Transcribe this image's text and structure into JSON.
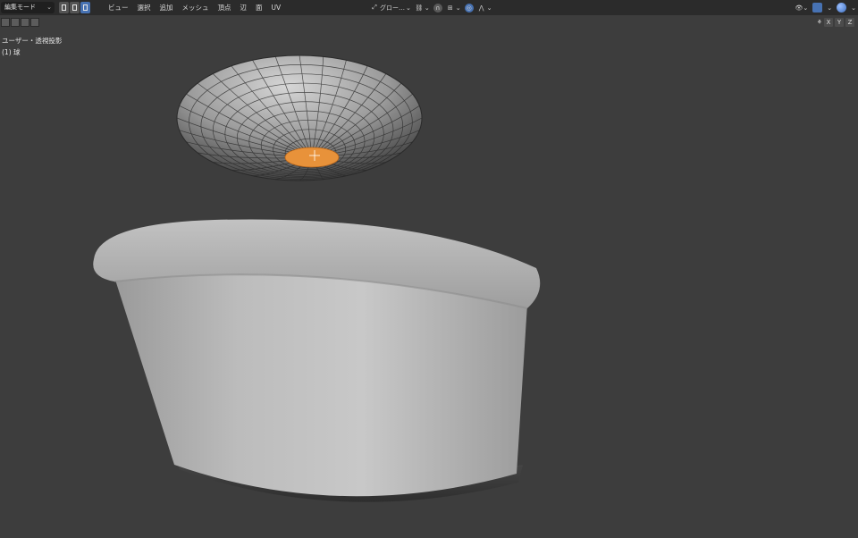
{
  "header": {
    "mode_label": "編集モード",
    "menu": [
      "ビュー",
      "選択",
      "追加",
      "メッシュ",
      "頂点",
      "辺",
      "面",
      "UV"
    ],
    "transform_orientation": "グロー…"
  },
  "viewport": {
    "view_name": "ユーザー・透視投影",
    "object_name": "(1) 球"
  },
  "axes": [
    "X",
    "Y",
    "Z"
  ],
  "colors": {
    "accent": "#4772b3",
    "selection": "#e8923a",
    "background": "#3d3d3d",
    "header": "#2b2b2b"
  }
}
